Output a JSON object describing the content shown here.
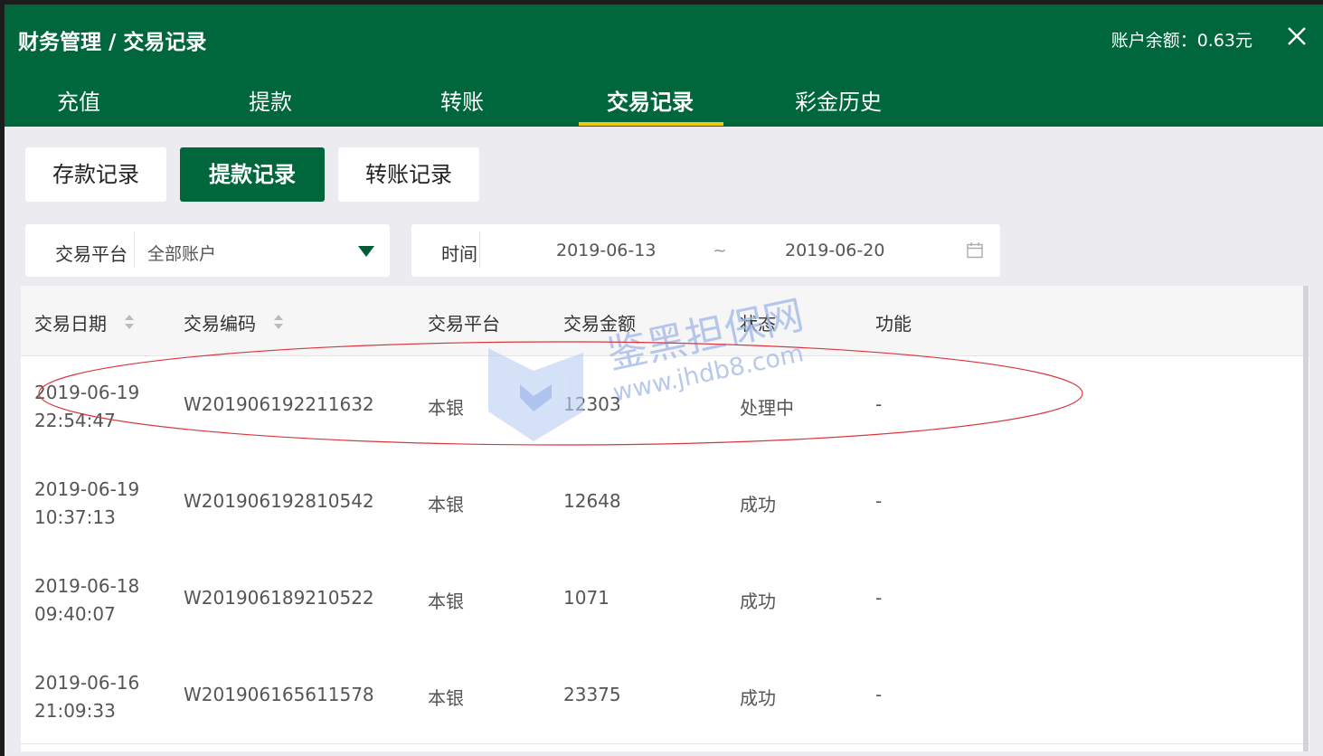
{
  "header": {
    "title": "财务管理 / 交易记录",
    "balance": "账户余额：0.63元",
    "close_icon": "close-icon"
  },
  "tabs": [
    {
      "label": "充值"
    },
    {
      "label": "提款"
    },
    {
      "label": "转账"
    },
    {
      "label": "交易记录",
      "active": true
    },
    {
      "label": "彩金历史"
    }
  ],
  "subtabs": [
    {
      "label": "存款记录"
    },
    {
      "label": "提款记录",
      "active": true
    },
    {
      "label": "转账记录"
    }
  ],
  "filters": {
    "platform_label": "交易平台",
    "platform_value": "全部账户",
    "time_label": "时间",
    "date_start": "2019-06-13",
    "date_sep": "~",
    "date_end": "2019-06-20",
    "calendar_icon": "calendar-icon"
  },
  "table": {
    "headers": [
      "交易日期",
      "交易编码",
      "交易平台",
      "交易金额",
      "状态",
      "功能"
    ],
    "rows": [
      {
        "date": "2019-06-19",
        "time": "22:54:47",
        "code": "W201906192211632",
        "platform": "本银",
        "amount": "12303",
        "status": "处理中",
        "func": "-"
      },
      {
        "date": "2019-06-19",
        "time": "10:37:13",
        "code": "W201906192810542",
        "platform": "本银",
        "amount": "12648",
        "status": "成功",
        "func": "-"
      },
      {
        "date": "2019-06-18",
        "time": "09:40:07",
        "code": "W201906189210522",
        "platform": "本银",
        "amount": "1071",
        "status": "成功",
        "func": "-"
      },
      {
        "date": "2019-06-16",
        "time": "21:09:33",
        "code": "W201906165611578",
        "platform": "本银",
        "amount": "23375",
        "status": "成功",
        "func": "-"
      }
    ]
  },
  "watermark": {
    "title": "鉴黑担保网",
    "url": "www.jhdb8.com"
  },
  "colors": {
    "primary": "#00663b",
    "accent": "#f2c511",
    "annotation": "#d9363e"
  }
}
